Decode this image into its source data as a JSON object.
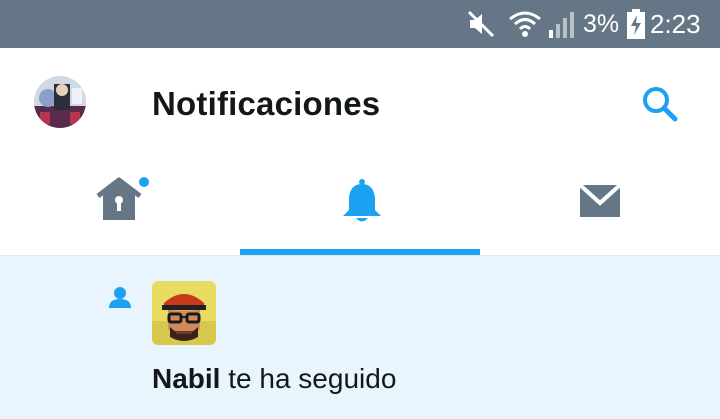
{
  "status_bar": {
    "battery_percent": "3%",
    "time": "2:23",
    "icons": [
      "mute-icon",
      "wifi-icon",
      "signal-icon",
      "battery-charging-icon"
    ]
  },
  "header": {
    "title": "Notificaciones",
    "icons": [
      "profile-avatar",
      "search-icon"
    ]
  },
  "tabs": [
    {
      "name": "home",
      "icon": "home-icon",
      "has_unread_dot": true,
      "active": false
    },
    {
      "name": "notifications",
      "icon": "bell-icon",
      "active": true
    },
    {
      "name": "messages",
      "icon": "envelope-icon",
      "active": false
    }
  ],
  "notifications": [
    {
      "type_icon": "follow-person-icon",
      "user_name": "Nabil",
      "action_text": " te ha seguido"
    }
  ],
  "colors": {
    "status_bar_bg": "#657786",
    "accent": "#1da1f2",
    "icon_gray": "#657786",
    "text": "#14171a",
    "unread_bg": "#e8f5fd"
  }
}
